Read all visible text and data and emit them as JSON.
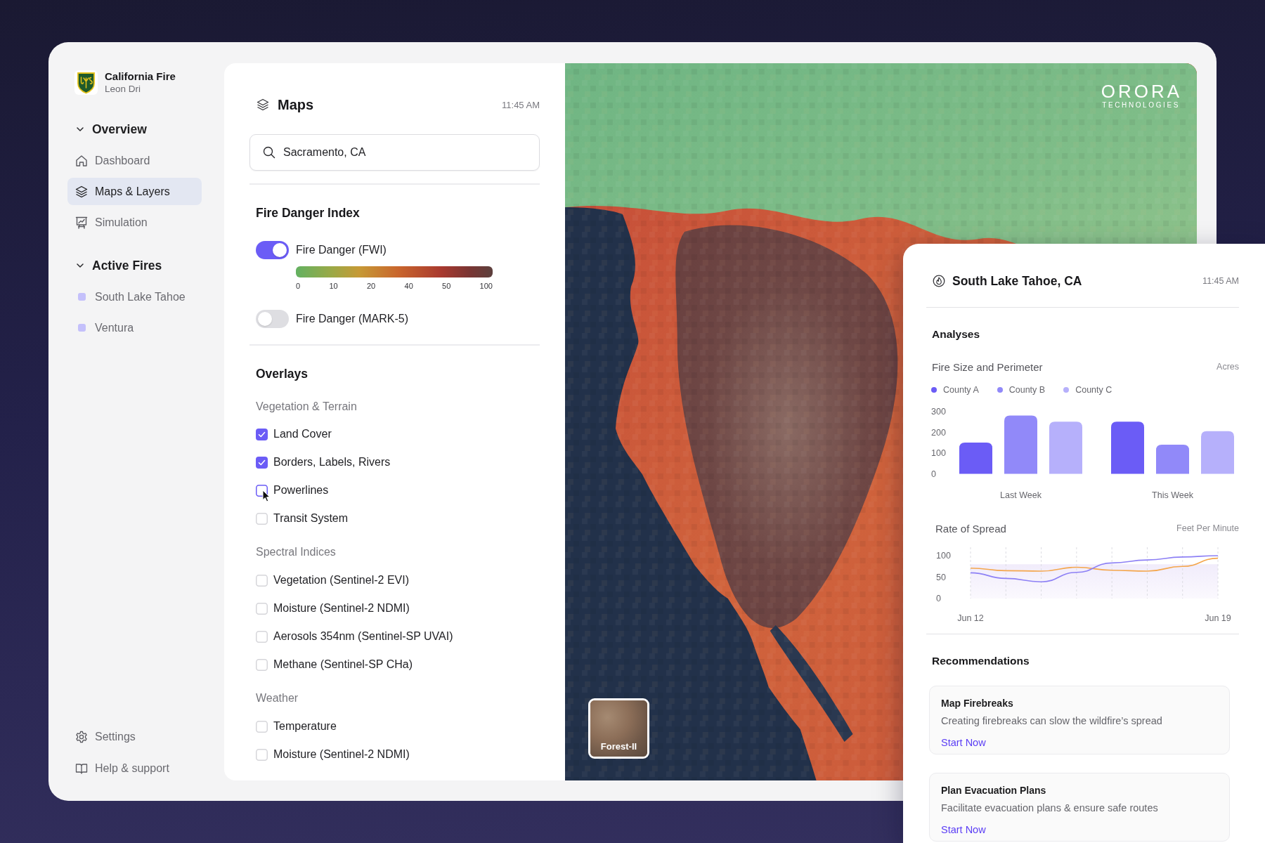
{
  "sidebar": {
    "brand": {
      "name": "California Fire",
      "user": "Leon Dri"
    },
    "sections": [
      {
        "title": "Overview",
        "expanded": true,
        "items": [
          {
            "label": "Dashboard",
            "kind": "page",
            "selected": false
          },
          {
            "label": "Maps & Layers",
            "kind": "page",
            "selected": true
          },
          {
            "label": "Simulation",
            "kind": "page",
            "selected": false
          }
        ]
      },
      {
        "title": "Active Fires",
        "expanded": true,
        "items": [
          {
            "label": "South Lake Tahoe",
            "kind": "fire",
            "selected": false
          },
          {
            "label": "Ventura",
            "kind": "fire",
            "selected": false
          }
        ]
      }
    ],
    "footer": [
      {
        "label": "Settings",
        "kind": "page",
        "selected": false
      },
      {
        "label": "Help & support",
        "kind": "page",
        "selected": false
      }
    ]
  },
  "maps_panel": {
    "title": "Maps",
    "time": "11:45 AM",
    "search": {
      "value": "Sacramento, CA"
    },
    "fire_danger": {
      "title": "Fire Danger Index",
      "layers": [
        {
          "label": "Fire Danger (FWI)",
          "on": true,
          "scale": [
            "0",
            "10",
            "20",
            "40",
            "50",
            "100"
          ]
        },
        {
          "label": "Fire Danger (MARK-5)",
          "on": false
        }
      ]
    },
    "overlays": {
      "title": "Overlays",
      "groups": [
        {
          "title": "Vegetation & Terrain",
          "items": [
            {
              "label": "Land Cover",
              "checked": true,
              "hovered": false
            },
            {
              "label": "Borders, Labels, Rivers",
              "checked": true,
              "hovered": false
            },
            {
              "label": "Powerlines",
              "checked": false,
              "hovered": true
            },
            {
              "label": "Transit System",
              "checked": false,
              "hovered": false
            }
          ]
        },
        {
          "title": "Spectral Indices",
          "items": [
            {
              "label": "Vegetation (Sentinel-2 EVI)",
              "checked": false,
              "hovered": false
            },
            {
              "label": "Moisture (Sentinel-2 NDMI)",
              "checked": false,
              "hovered": false
            },
            {
              "label": "Aerosols 354nm (Sentinel-SP UVAI)",
              "checked": false,
              "hovered": false
            },
            {
              "label": "Methane (Sentinel-SP CHa)",
              "checked": false,
              "hovered": false
            }
          ]
        },
        {
          "title": "Weather",
          "items": [
            {
              "label": "Temperature",
              "checked": false,
              "hovered": false
            },
            {
              "label": "Moisture (Sentinel-2 NDMI)",
              "checked": false,
              "hovered": false
            }
          ]
        }
      ]
    }
  },
  "map": {
    "logo": {
      "name": "ORORA",
      "tagline": "TECHNOLOGIES"
    },
    "basemap": {
      "label": "Forest-II"
    }
  },
  "fire_card": {
    "title": "South Lake Tahoe, CA",
    "time": "11:45 AM",
    "section_title": "Analyses",
    "fire_size": {
      "title": "Fire Size and Perimeter",
      "unit": "Acres",
      "chart_data": {
        "type": "bar",
        "categories": [
          "Last Week",
          "This Week"
        ],
        "series": [
          {
            "name": "County A",
            "color": "#6b5cf6",
            "values": [
              150,
              250
            ]
          },
          {
            "name": "County B",
            "color": "#9189f9",
            "values": [
              280,
              140
            ]
          },
          {
            "name": "County C",
            "color": "#b6b0fb",
            "values": [
              250,
              205
            ]
          }
        ],
        "ylim": [
          0,
          300
        ],
        "yticks": [
          0,
          100,
          200,
          300
        ]
      }
    },
    "rate_of_spread": {
      "title": "Rate of Spread",
      "unit": "Feet Per Minute",
      "chart_data": {
        "type": "line",
        "categories": [
          "Jun 12",
          null,
          null,
          null,
          null,
          null,
          null,
          "Jun 19"
        ],
        "ylim": [
          0,
          100
        ],
        "yticks": [
          0,
          50,
          100
        ],
        "grid": true,
        "series": [
          {
            "color": "#f4a64c",
            "values": [
              71,
              65,
              64,
              73,
              66,
              64,
              75,
              94
            ]
          },
          {
            "color": "#8d80f5",
            "values": [
              60,
              47,
              39,
              61,
              83,
              90,
              97,
              100
            ]
          }
        ]
      }
    },
    "recommendations": {
      "title": "Recommendations",
      "items": [
        {
          "title": "Map Firebreaks",
          "description": "Creating firebreaks can slow the wildfire’s spread",
          "action": "Start Now"
        },
        {
          "title": "Plan Evacuation Plans",
          "description": "Facilitate evacuation plans & ensure safe routes",
          "action": "Start Now"
        }
      ]
    }
  }
}
